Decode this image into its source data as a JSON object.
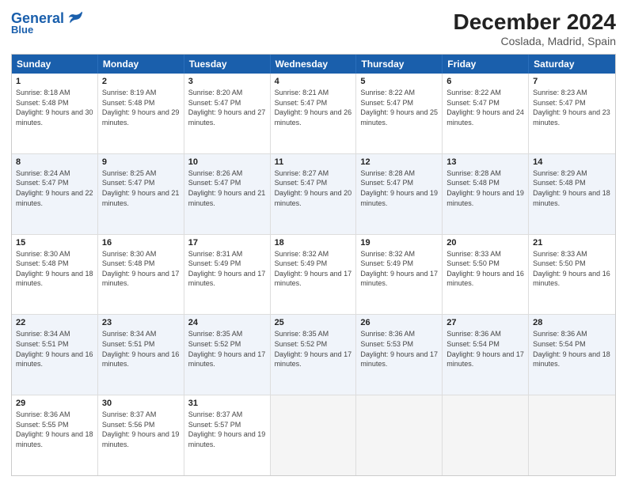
{
  "header": {
    "logo_line1": "General",
    "logo_line2": "Blue",
    "title": "December 2024",
    "subtitle": "Coslada, Madrid, Spain"
  },
  "weekdays": [
    "Sunday",
    "Monday",
    "Tuesday",
    "Wednesday",
    "Thursday",
    "Friday",
    "Saturday"
  ],
  "rows": [
    [
      {
        "day": "1",
        "sunrise": "Sunrise: 8:18 AM",
        "sunset": "Sunset: 5:48 PM",
        "daylight": "Daylight: 9 hours and 30 minutes."
      },
      {
        "day": "2",
        "sunrise": "Sunrise: 8:19 AM",
        "sunset": "Sunset: 5:48 PM",
        "daylight": "Daylight: 9 hours and 29 minutes."
      },
      {
        "day": "3",
        "sunrise": "Sunrise: 8:20 AM",
        "sunset": "Sunset: 5:47 PM",
        "daylight": "Daylight: 9 hours and 27 minutes."
      },
      {
        "day": "4",
        "sunrise": "Sunrise: 8:21 AM",
        "sunset": "Sunset: 5:47 PM",
        "daylight": "Daylight: 9 hours and 26 minutes."
      },
      {
        "day": "5",
        "sunrise": "Sunrise: 8:22 AM",
        "sunset": "Sunset: 5:47 PM",
        "daylight": "Daylight: 9 hours and 25 minutes."
      },
      {
        "day": "6",
        "sunrise": "Sunrise: 8:22 AM",
        "sunset": "Sunset: 5:47 PM",
        "daylight": "Daylight: 9 hours and 24 minutes."
      },
      {
        "day": "7",
        "sunrise": "Sunrise: 8:23 AM",
        "sunset": "Sunset: 5:47 PM",
        "daylight": "Daylight: 9 hours and 23 minutes."
      }
    ],
    [
      {
        "day": "8",
        "sunrise": "Sunrise: 8:24 AM",
        "sunset": "Sunset: 5:47 PM",
        "daylight": "Daylight: 9 hours and 22 minutes."
      },
      {
        "day": "9",
        "sunrise": "Sunrise: 8:25 AM",
        "sunset": "Sunset: 5:47 PM",
        "daylight": "Daylight: 9 hours and 21 minutes."
      },
      {
        "day": "10",
        "sunrise": "Sunrise: 8:26 AM",
        "sunset": "Sunset: 5:47 PM",
        "daylight": "Daylight: 9 hours and 21 minutes."
      },
      {
        "day": "11",
        "sunrise": "Sunrise: 8:27 AM",
        "sunset": "Sunset: 5:47 PM",
        "daylight": "Daylight: 9 hours and 20 minutes."
      },
      {
        "day": "12",
        "sunrise": "Sunrise: 8:28 AM",
        "sunset": "Sunset: 5:47 PM",
        "daylight": "Daylight: 9 hours and 19 minutes."
      },
      {
        "day": "13",
        "sunrise": "Sunrise: 8:28 AM",
        "sunset": "Sunset: 5:48 PM",
        "daylight": "Daylight: 9 hours and 19 minutes."
      },
      {
        "day": "14",
        "sunrise": "Sunrise: 8:29 AM",
        "sunset": "Sunset: 5:48 PM",
        "daylight": "Daylight: 9 hours and 18 minutes."
      }
    ],
    [
      {
        "day": "15",
        "sunrise": "Sunrise: 8:30 AM",
        "sunset": "Sunset: 5:48 PM",
        "daylight": "Daylight: 9 hours and 18 minutes."
      },
      {
        "day": "16",
        "sunrise": "Sunrise: 8:30 AM",
        "sunset": "Sunset: 5:48 PM",
        "daylight": "Daylight: 9 hours and 17 minutes."
      },
      {
        "day": "17",
        "sunrise": "Sunrise: 8:31 AM",
        "sunset": "Sunset: 5:49 PM",
        "daylight": "Daylight: 9 hours and 17 minutes."
      },
      {
        "day": "18",
        "sunrise": "Sunrise: 8:32 AM",
        "sunset": "Sunset: 5:49 PM",
        "daylight": "Daylight: 9 hours and 17 minutes."
      },
      {
        "day": "19",
        "sunrise": "Sunrise: 8:32 AM",
        "sunset": "Sunset: 5:49 PM",
        "daylight": "Daylight: 9 hours and 17 minutes."
      },
      {
        "day": "20",
        "sunrise": "Sunrise: 8:33 AM",
        "sunset": "Sunset: 5:50 PM",
        "daylight": "Daylight: 9 hours and 16 minutes."
      },
      {
        "day": "21",
        "sunrise": "Sunrise: 8:33 AM",
        "sunset": "Sunset: 5:50 PM",
        "daylight": "Daylight: 9 hours and 16 minutes."
      }
    ],
    [
      {
        "day": "22",
        "sunrise": "Sunrise: 8:34 AM",
        "sunset": "Sunset: 5:51 PM",
        "daylight": "Daylight: 9 hours and 16 minutes."
      },
      {
        "day": "23",
        "sunrise": "Sunrise: 8:34 AM",
        "sunset": "Sunset: 5:51 PM",
        "daylight": "Daylight: 9 hours and 16 minutes."
      },
      {
        "day": "24",
        "sunrise": "Sunrise: 8:35 AM",
        "sunset": "Sunset: 5:52 PM",
        "daylight": "Daylight: 9 hours and 17 minutes."
      },
      {
        "day": "25",
        "sunrise": "Sunrise: 8:35 AM",
        "sunset": "Sunset: 5:52 PM",
        "daylight": "Daylight: 9 hours and 17 minutes."
      },
      {
        "day": "26",
        "sunrise": "Sunrise: 8:36 AM",
        "sunset": "Sunset: 5:53 PM",
        "daylight": "Daylight: 9 hours and 17 minutes."
      },
      {
        "day": "27",
        "sunrise": "Sunrise: 8:36 AM",
        "sunset": "Sunset: 5:54 PM",
        "daylight": "Daylight: 9 hours and 17 minutes."
      },
      {
        "day": "28",
        "sunrise": "Sunrise: 8:36 AM",
        "sunset": "Sunset: 5:54 PM",
        "daylight": "Daylight: 9 hours and 18 minutes."
      }
    ],
    [
      {
        "day": "29",
        "sunrise": "Sunrise: 8:36 AM",
        "sunset": "Sunset: 5:55 PM",
        "daylight": "Daylight: 9 hours and 18 minutes."
      },
      {
        "day": "30",
        "sunrise": "Sunrise: 8:37 AM",
        "sunset": "Sunset: 5:56 PM",
        "daylight": "Daylight: 9 hours and 19 minutes."
      },
      {
        "day": "31",
        "sunrise": "Sunrise: 8:37 AM",
        "sunset": "Sunset: 5:57 PM",
        "daylight": "Daylight: 9 hours and 19 minutes."
      },
      null,
      null,
      null,
      null
    ]
  ]
}
